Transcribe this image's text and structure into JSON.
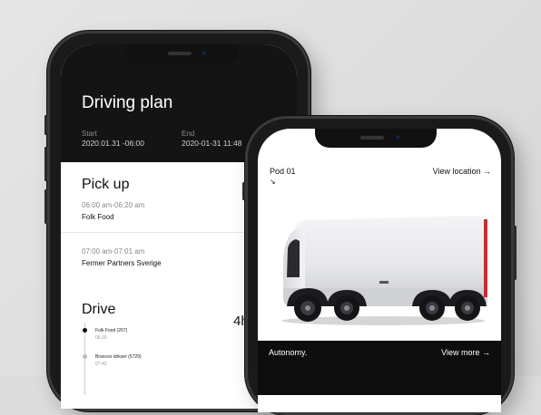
{
  "driving_plan": {
    "title": "Driving plan",
    "start_label": "Start",
    "start_value": "2020.01.31 -06:00",
    "end_label": "End",
    "end_value": "2020-01-31 11:48",
    "pickup_title": "Pick up",
    "pickups": [
      {
        "time": "06:00 am-06:20 am",
        "place": "Folk Food"
      },
      {
        "time": "07:00 am-07:01 am",
        "place": "Fermer Partners Sverige"
      }
    ],
    "drive_title": "Drive",
    "drive_duration": "4h",
    "timeline": [
      {
        "name": "Folk Food  (267)",
        "time": "06:20"
      },
      {
        "name": "Brancos drikser (5729)",
        "time": "07:43"
      }
    ]
  },
  "pod_view": {
    "pod_label": "Pod 01",
    "pod_arrow": "↘",
    "view_location": "View location →",
    "autonomy": "Autonomy.",
    "view_more": "View more →"
  },
  "colors": {
    "dark_header": "#141414",
    "accent_red": "#d9262b",
    "timeline_dot_active": "#111111",
    "timeline_dot_idle": "#bbbbbb"
  }
}
